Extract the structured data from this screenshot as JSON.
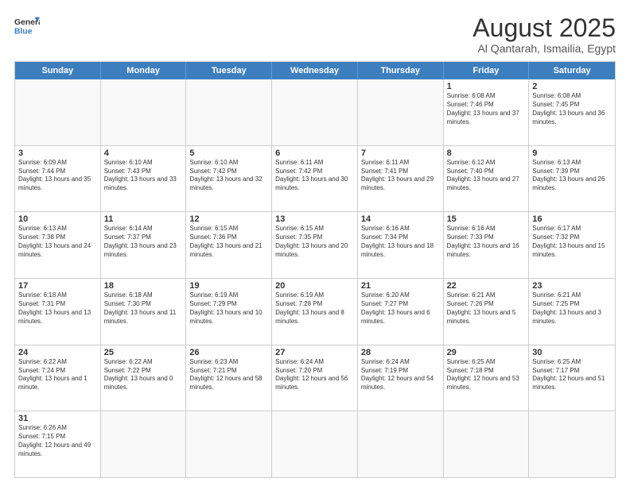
{
  "header": {
    "logo_general": "General",
    "logo_blue": "Blue",
    "month_title": "August 2025",
    "location": "Al Qantarah, Ismailia, Egypt"
  },
  "weekdays": [
    "Sunday",
    "Monday",
    "Tuesday",
    "Wednesday",
    "Thursday",
    "Friday",
    "Saturday"
  ],
  "weeks": [
    [
      {
        "day": "",
        "text": ""
      },
      {
        "day": "",
        "text": ""
      },
      {
        "day": "",
        "text": ""
      },
      {
        "day": "",
        "text": ""
      },
      {
        "day": "",
        "text": ""
      },
      {
        "day": "1",
        "text": "Sunrise: 6:08 AM\nSunset: 7:46 PM\nDaylight: 13 hours and 37 minutes."
      },
      {
        "day": "2",
        "text": "Sunrise: 6:08 AM\nSunset: 7:45 PM\nDaylight: 13 hours and 36 minutes."
      }
    ],
    [
      {
        "day": "3",
        "text": "Sunrise: 6:09 AM\nSunset: 7:44 PM\nDaylight: 13 hours and 35 minutes."
      },
      {
        "day": "4",
        "text": "Sunrise: 6:10 AM\nSunset: 7:43 PM\nDaylight: 13 hours and 33 minutes."
      },
      {
        "day": "5",
        "text": "Sunrise: 6:10 AM\nSunset: 7:42 PM\nDaylight: 13 hours and 32 minutes."
      },
      {
        "day": "6",
        "text": "Sunrise: 6:11 AM\nSunset: 7:42 PM\nDaylight: 13 hours and 30 minutes."
      },
      {
        "day": "7",
        "text": "Sunrise: 6:11 AM\nSunset: 7:41 PM\nDaylight: 13 hours and 29 minutes."
      },
      {
        "day": "8",
        "text": "Sunrise: 6:12 AM\nSunset: 7:40 PM\nDaylight: 13 hours and 27 minutes."
      },
      {
        "day": "9",
        "text": "Sunrise: 6:13 AM\nSunset: 7:39 PM\nDaylight: 13 hours and 26 minutes."
      }
    ],
    [
      {
        "day": "10",
        "text": "Sunrise: 6:13 AM\nSunset: 7:38 PM\nDaylight: 13 hours and 24 minutes."
      },
      {
        "day": "11",
        "text": "Sunrise: 6:14 AM\nSunset: 7:37 PM\nDaylight: 13 hours and 23 minutes."
      },
      {
        "day": "12",
        "text": "Sunrise: 6:15 AM\nSunset: 7:36 PM\nDaylight: 13 hours and 21 minutes."
      },
      {
        "day": "13",
        "text": "Sunrise: 6:15 AM\nSunset: 7:35 PM\nDaylight: 13 hours and 20 minutes."
      },
      {
        "day": "14",
        "text": "Sunrise: 6:16 AM\nSunset: 7:34 PM\nDaylight: 13 hours and 18 minutes."
      },
      {
        "day": "15",
        "text": "Sunrise: 6:16 AM\nSunset: 7:33 PM\nDaylight: 13 hours and 16 minutes."
      },
      {
        "day": "16",
        "text": "Sunrise: 6:17 AM\nSunset: 7:32 PM\nDaylight: 13 hours and 15 minutes."
      }
    ],
    [
      {
        "day": "17",
        "text": "Sunrise: 6:18 AM\nSunset: 7:31 PM\nDaylight: 13 hours and 13 minutes."
      },
      {
        "day": "18",
        "text": "Sunrise: 6:18 AM\nSunset: 7:30 PM\nDaylight: 13 hours and 11 minutes."
      },
      {
        "day": "19",
        "text": "Sunrise: 6:19 AM\nSunset: 7:29 PM\nDaylight: 13 hours and 10 minutes."
      },
      {
        "day": "20",
        "text": "Sunrise: 6:19 AM\nSunset: 7:28 PM\nDaylight: 13 hours and 8 minutes."
      },
      {
        "day": "21",
        "text": "Sunrise: 6:20 AM\nSunset: 7:27 PM\nDaylight: 13 hours and 6 minutes."
      },
      {
        "day": "22",
        "text": "Sunrise: 6:21 AM\nSunset: 7:26 PM\nDaylight: 13 hours and 5 minutes."
      },
      {
        "day": "23",
        "text": "Sunrise: 6:21 AM\nSunset: 7:25 PM\nDaylight: 13 hours and 3 minutes."
      }
    ],
    [
      {
        "day": "24",
        "text": "Sunrise: 6:22 AM\nSunset: 7:24 PM\nDaylight: 13 hours and 1 minute."
      },
      {
        "day": "25",
        "text": "Sunrise: 6:22 AM\nSunset: 7:22 PM\nDaylight: 13 hours and 0 minutes."
      },
      {
        "day": "26",
        "text": "Sunrise: 6:23 AM\nSunset: 7:21 PM\nDaylight: 12 hours and 58 minutes."
      },
      {
        "day": "27",
        "text": "Sunrise: 6:24 AM\nSunset: 7:20 PM\nDaylight: 12 hours and 56 minutes."
      },
      {
        "day": "28",
        "text": "Sunrise: 6:24 AM\nSunset: 7:19 PM\nDaylight: 12 hours and 54 minutes."
      },
      {
        "day": "29",
        "text": "Sunrise: 6:25 AM\nSunset: 7:18 PM\nDaylight: 12 hours and 53 minutes."
      },
      {
        "day": "30",
        "text": "Sunrise: 6:25 AM\nSunset: 7:17 PM\nDaylight: 12 hours and 51 minutes."
      }
    ],
    [
      {
        "day": "31",
        "text": "Sunrise: 6:26 AM\nSunset: 7:15 PM\nDaylight: 12 hours and 49 minutes."
      },
      {
        "day": "",
        "text": ""
      },
      {
        "day": "",
        "text": ""
      },
      {
        "day": "",
        "text": ""
      },
      {
        "day": "",
        "text": ""
      },
      {
        "day": "",
        "text": ""
      },
      {
        "day": "",
        "text": ""
      }
    ]
  ]
}
